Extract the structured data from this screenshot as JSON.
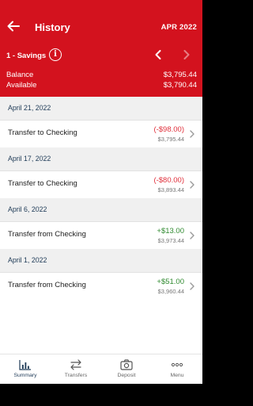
{
  "header": {
    "title": "History",
    "month": "APR 2022"
  },
  "account": {
    "label": "1 - Savings",
    "info_icon": "info-icon",
    "balance_label": "Balance",
    "balance_value": "$3,795.44",
    "available_label": "Available",
    "available_value": "$3,790.44"
  },
  "transactions": [
    {
      "date": "April 21, 2022",
      "description": "Transfer to Checking",
      "amount": "(-$98.00)",
      "type": "debit",
      "running_balance": "$3,795.44"
    },
    {
      "date": "April 17, 2022",
      "description": "Transfer to Checking",
      "amount": "(-$80.00)",
      "type": "debit",
      "running_balance": "$3,893.44"
    },
    {
      "date": "April 6, 2022",
      "description": "Transfer from Checking",
      "amount": "+$13.00",
      "type": "credit",
      "running_balance": "$3,973.44"
    },
    {
      "date": "April 1, 2022",
      "description": "Transfer from Checking",
      "amount": "+$51.00",
      "type": "credit",
      "running_balance": "$3,960.44"
    }
  ],
  "nav": {
    "items": [
      {
        "label": "Summary",
        "icon": "bar-chart-icon"
      },
      {
        "label": "Transfers",
        "icon": "swap-arrows-icon"
      },
      {
        "label": "Deposit",
        "icon": "camera-icon"
      },
      {
        "label": "Menu",
        "icon": "more-dots-icon"
      }
    ]
  },
  "colors": {
    "brand_red": "#d3121e",
    "debit": "#e0303b",
    "credit": "#2f8a2f",
    "date_text": "#1f3b57"
  }
}
